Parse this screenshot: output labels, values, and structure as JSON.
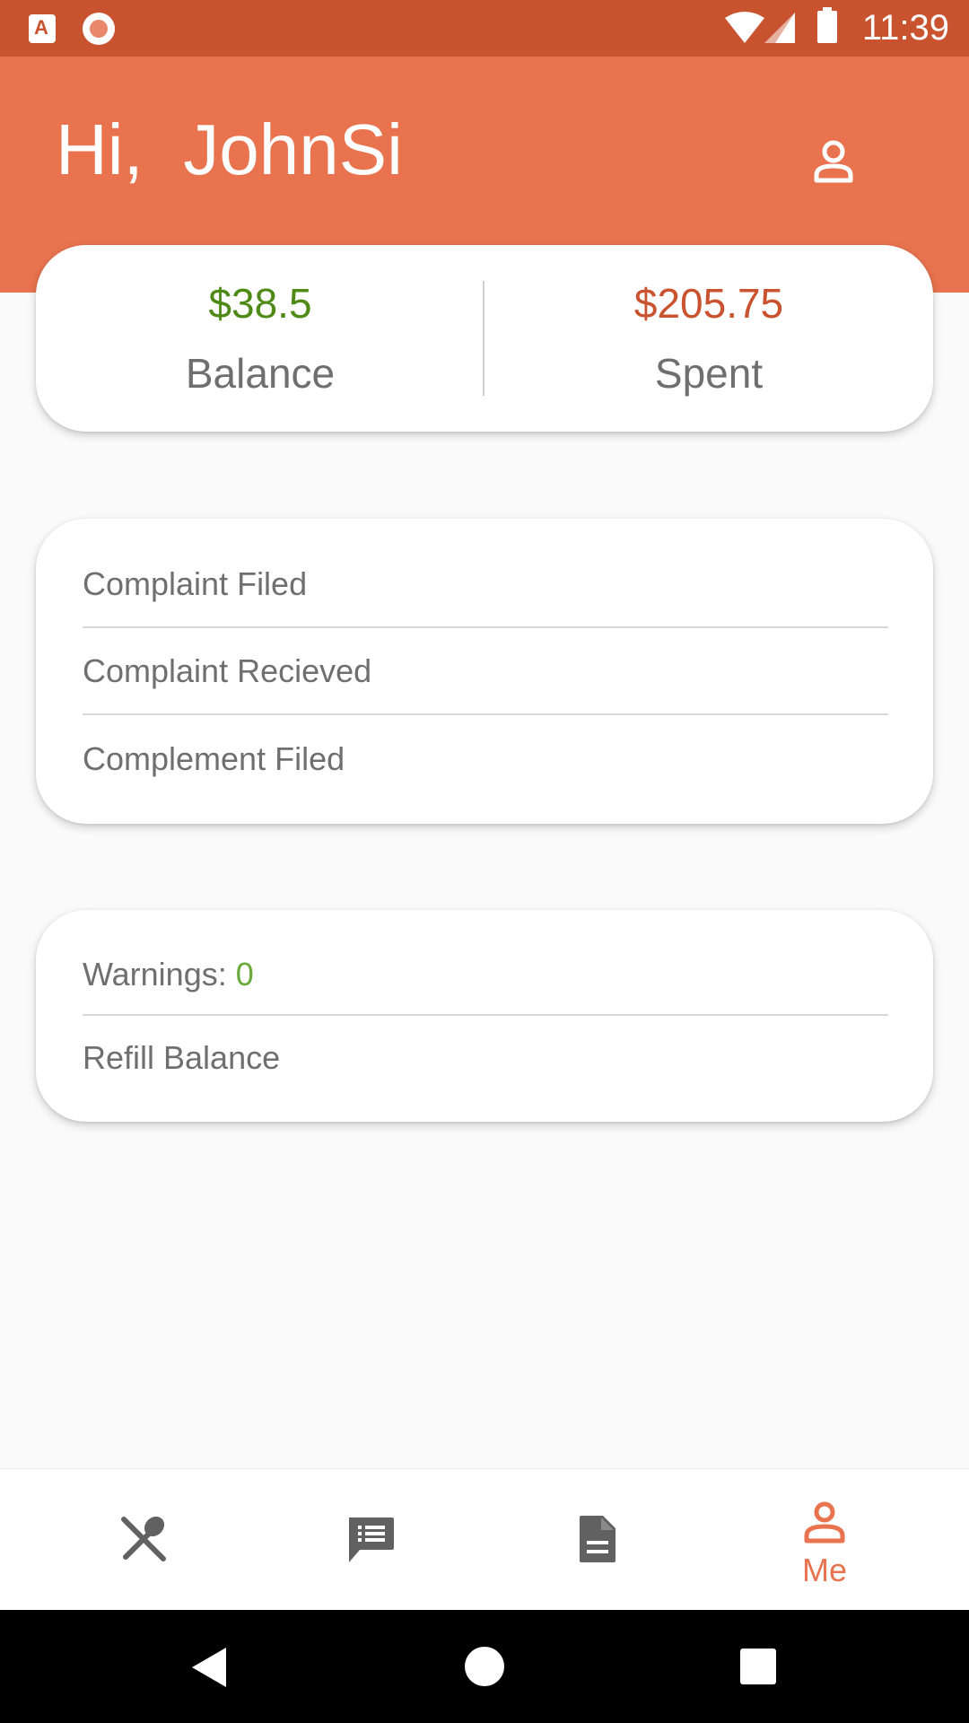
{
  "status_bar": {
    "time": "11:39",
    "app_badge_letter": "A",
    "icons": [
      "app-a-icon",
      "record-icon",
      "wifi-icon",
      "signal-icon",
      "battery-icon"
    ]
  },
  "header": {
    "greeting": "Hi,  JohnSi",
    "profile_icon": "person-outline-icon"
  },
  "stats": {
    "balance_amount": "$38.5",
    "balance_label": "Balance",
    "spent_amount": "$205.75",
    "spent_label": "Spent"
  },
  "reports": {
    "items": [
      {
        "label": "Complaint Filed"
      },
      {
        "label": "Complaint Recieved"
      },
      {
        "label": "Complement Filed"
      }
    ]
  },
  "account": {
    "warnings_label": "Warnings:",
    "warnings_count": "0",
    "refill_label": "Refill Balance"
  },
  "bottom_nav": {
    "items": [
      {
        "icon": "fork-spoon-icon",
        "label": ""
      },
      {
        "icon": "chat-list-icon",
        "label": ""
      },
      {
        "icon": "document-icon",
        "label": ""
      },
      {
        "icon": "person-outline-icon",
        "label": "Me",
        "active": true
      }
    ]
  },
  "colors": {
    "status_bar": "#c9522f",
    "header": "#e8734e",
    "accent": "#e8734e",
    "balance_green": "#4f8a17",
    "spent_red": "#c9522f",
    "warning_green": "#6aaa3a",
    "text_gray": "#6f6f6f",
    "icon_gray": "#616161"
  }
}
